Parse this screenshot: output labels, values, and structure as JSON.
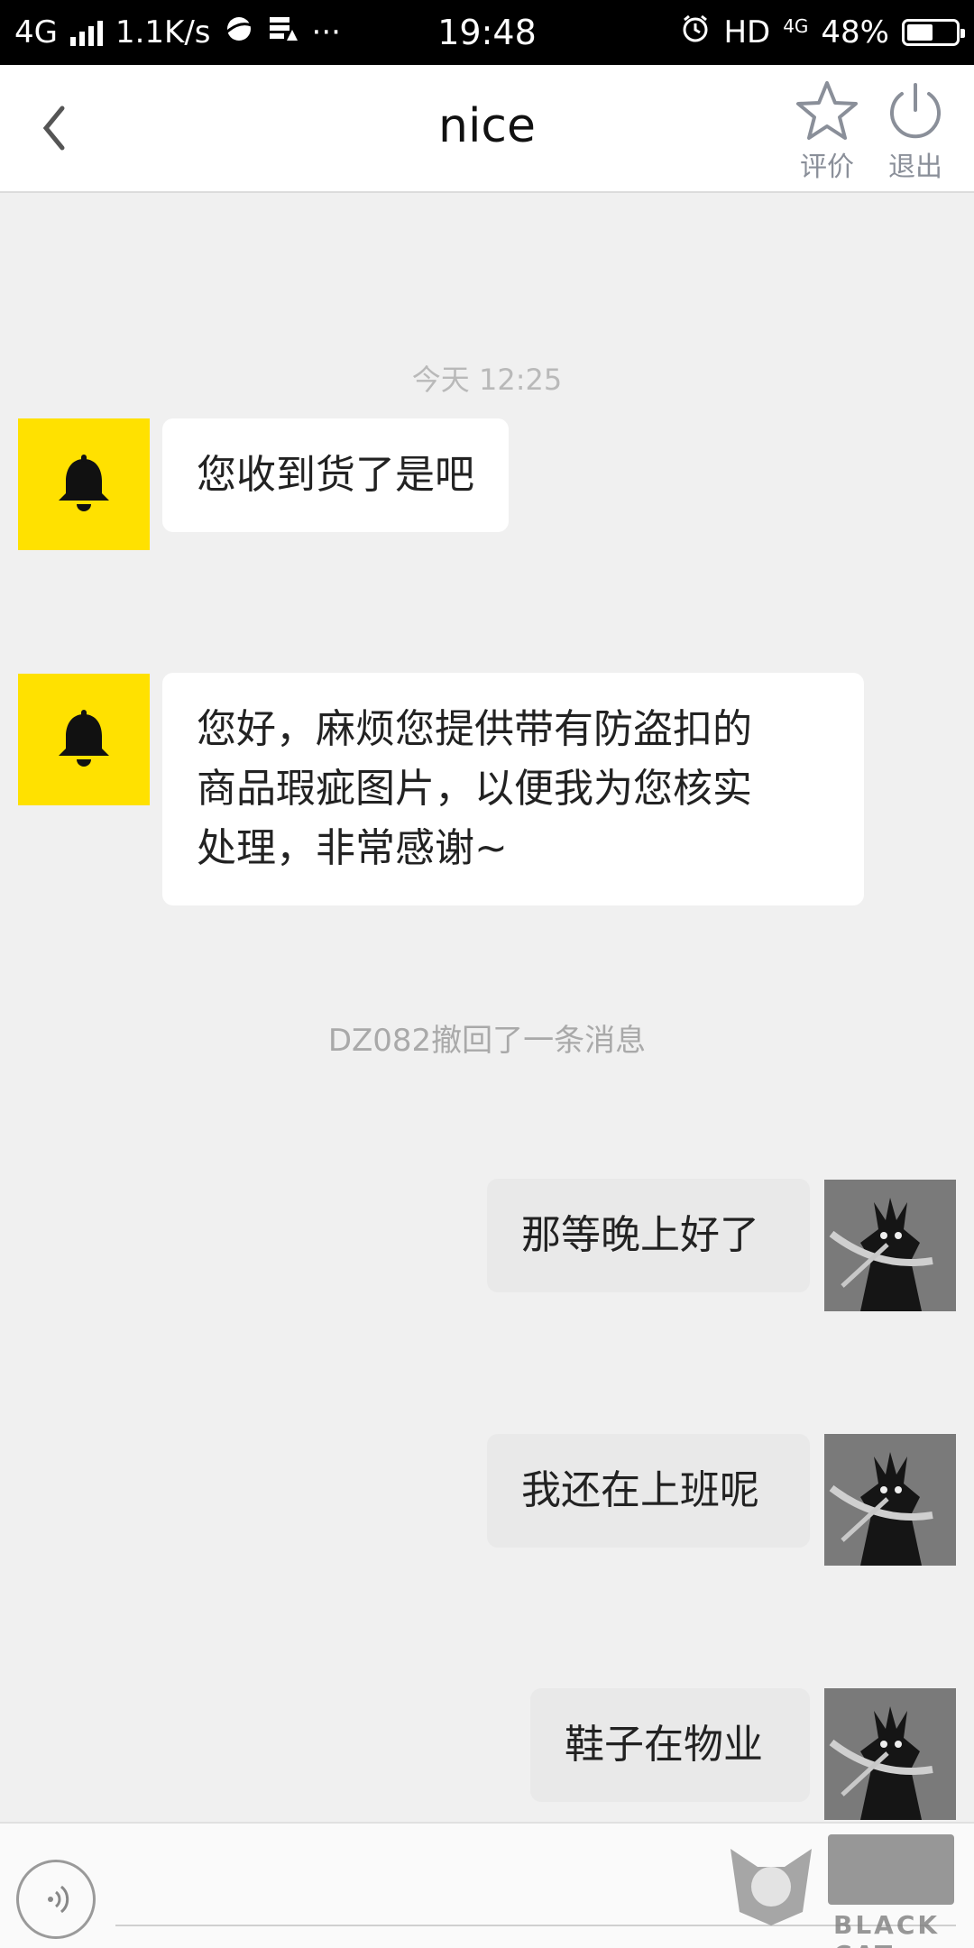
{
  "status_bar": {
    "network": "4G",
    "speed": "1.1K/s",
    "time": "19:48",
    "hd": "HD",
    "network2": "4G",
    "battery_text": "48%",
    "battery_level": 0.48
  },
  "header": {
    "title": "nice",
    "back_icon": "chevron-left-icon",
    "actions": [
      {
        "label": "评价",
        "icon": "star-icon"
      },
      {
        "label": "退出",
        "icon": "power-icon"
      }
    ]
  },
  "chat": {
    "timestamp": "今天 12:25",
    "notice": "DZ082撤回了一条消息",
    "messages": [
      {
        "side": "in",
        "text": "您收到货了是吧",
        "avatar": "bell-icon"
      },
      {
        "side": "in",
        "lines": [
          "您好，麻烦您提供带有防盗扣的",
          "商品瑕疵图片，以便我为您核实",
          "处理，非常感谢~"
        ],
        "avatar": "bell-icon"
      },
      {
        "side": "out",
        "text": "那等晚上好了",
        "avatar": "user-avatar"
      },
      {
        "side": "out",
        "text": "我还在上班呢",
        "avatar": "user-avatar"
      },
      {
        "side": "out",
        "text": "鞋子在物业",
        "avatar": "user-avatar"
      }
    ]
  },
  "input_bar": {
    "voice_icon": "voice-icon",
    "watermark_text": "BLACK CAT"
  },
  "colors": {
    "accent_yellow": "#ffe100",
    "background": "#f0f0f0",
    "bubble_in": "#ffffff",
    "bubble_out": "#e9e9e9"
  }
}
